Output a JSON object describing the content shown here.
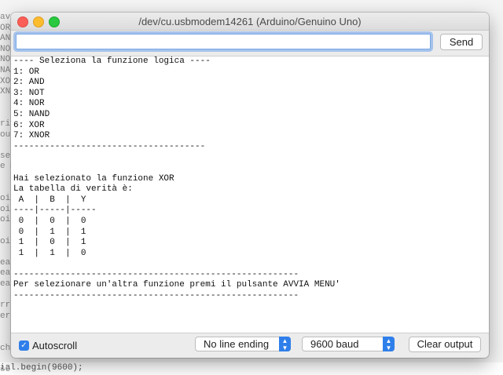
{
  "background_editor": {
    "lines": [
      "av",
      "OR",
      "AN",
      "NO",
      "NO",
      "NA",
      "XO",
      "XN",
      "",
      "",
      "riv",
      "oul",
      "",
      "se",
      "e m",
      "",
      "",
      "oin",
      "oin",
      "oin",
      "",
      "oin",
      "",
      "ean",
      "ean",
      "ean",
      "",
      "rra",
      "er",
      "",
      "",
      "chi",
      "",
      "se"
    ],
    "bottom_code": "ial.begin(9600);"
  },
  "window": {
    "title": "/dev/cu.usbmodem14261 (Arduino/Genuino Uno)"
  },
  "input": {
    "value": "",
    "send_label": "Send"
  },
  "output": {
    "text": "---- Seleziona la funzione logica ----\n1: OR\n2: AND\n3: NOT\n4: NOR\n5: NAND\n6: XOR\n7: XNOR\n-------------------------------------\n\n\nHai selezionato la funzione XOR\nLa tabella di verità è:\n A  |  B  |  Y\n----|-----|-----\n 0  |  0  |  0\n 0  |  1  |  1\n 1  |  0  |  1\n 1  |  1  |  0\n\n-------------------------------------------------------\nPer selezionare un'altra funzione premi il pulsante AVVIA MENU'\n-------------------------------------------------------"
  },
  "bottom": {
    "autoscroll_label": "Autoscroll",
    "autoscroll_checked": true,
    "line_ending": "No line ending",
    "baud": "9600 baud",
    "clear_label": "Clear output"
  },
  "colors": {
    "accent": "#2f7fea",
    "close": "#fc5f57",
    "minimize": "#fdbc2e",
    "maximize": "#2ac940"
  }
}
